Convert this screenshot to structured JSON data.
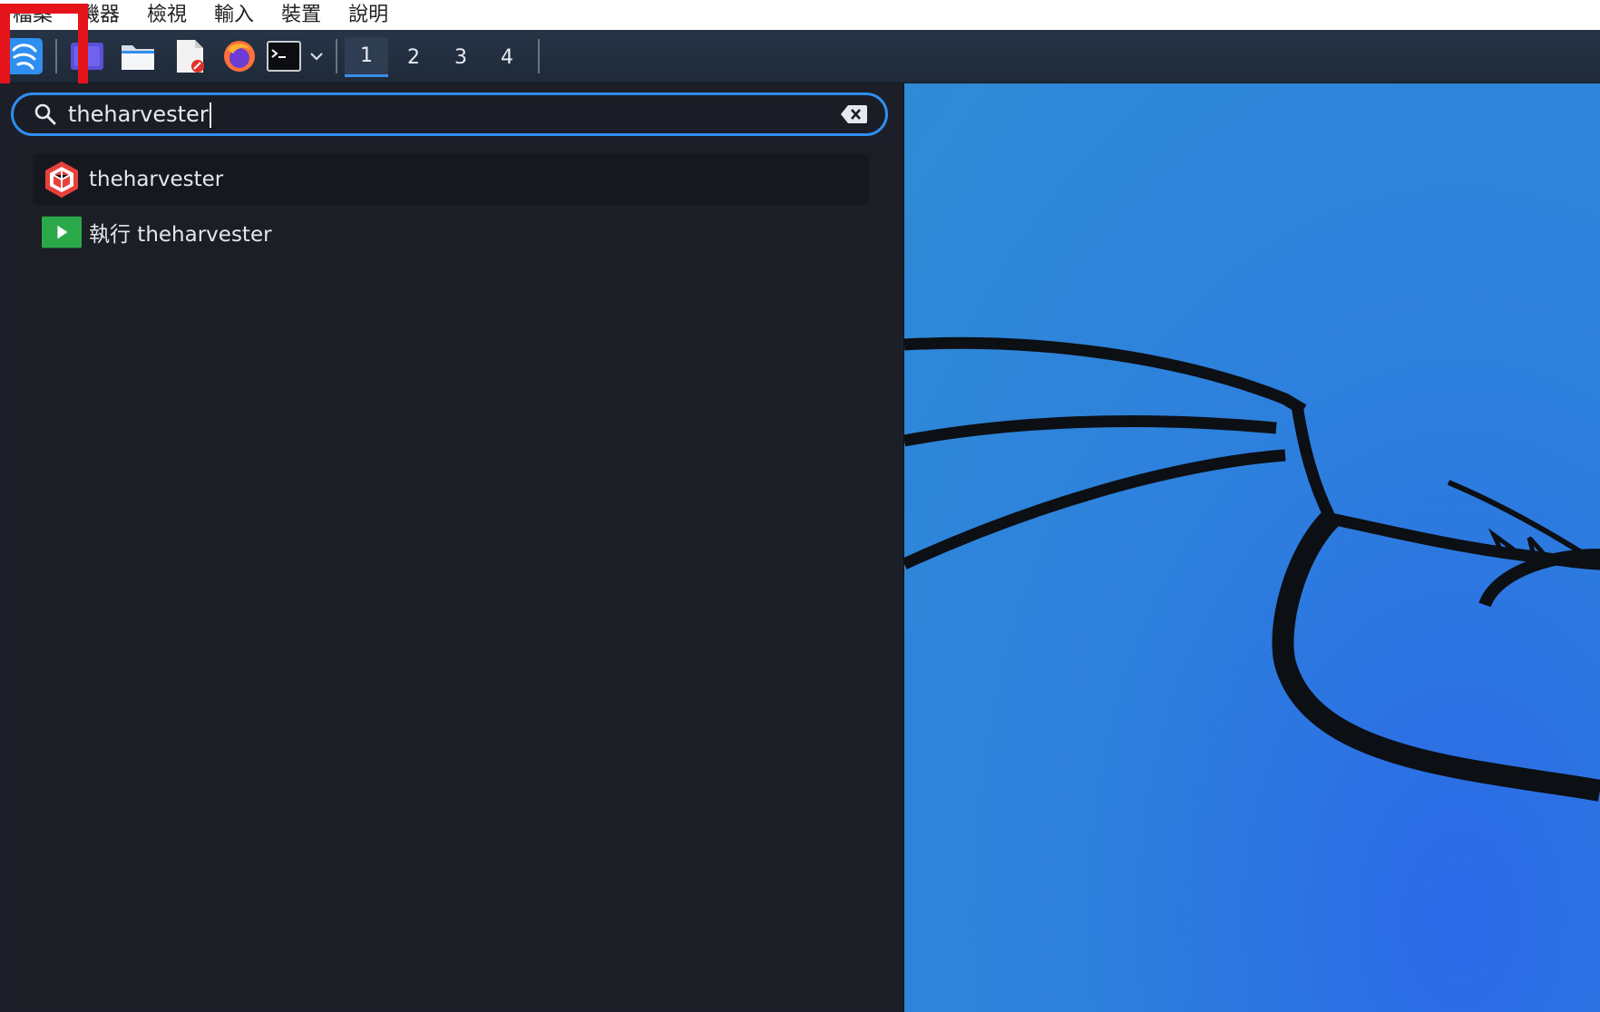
{
  "host_menubar": {
    "items": [
      "檔案",
      "機器",
      "檢視",
      "輸入",
      "裝置",
      "說明"
    ]
  },
  "panel": {
    "workspaces": [
      "1",
      "2",
      "3",
      "4"
    ],
    "active_workspace": "1",
    "launchers": [
      "kali-menu-icon",
      "workspace-switcher-icon",
      "file-manager-icon",
      "text-editor-icon",
      "firefox-icon",
      "terminal-icon",
      "chevron-down-icon"
    ]
  },
  "search": {
    "query": "theharvester"
  },
  "results": [
    {
      "label": "theharvester",
      "icon": "theharvester-app-icon"
    },
    {
      "label": "執行 theharvester",
      "icon": "run-command-icon"
    }
  ],
  "colors": {
    "accent": "#2f8ff0",
    "highlight": "#e5141b",
    "panel": "#1f2a39",
    "menu_bg": "#1c1f27"
  }
}
